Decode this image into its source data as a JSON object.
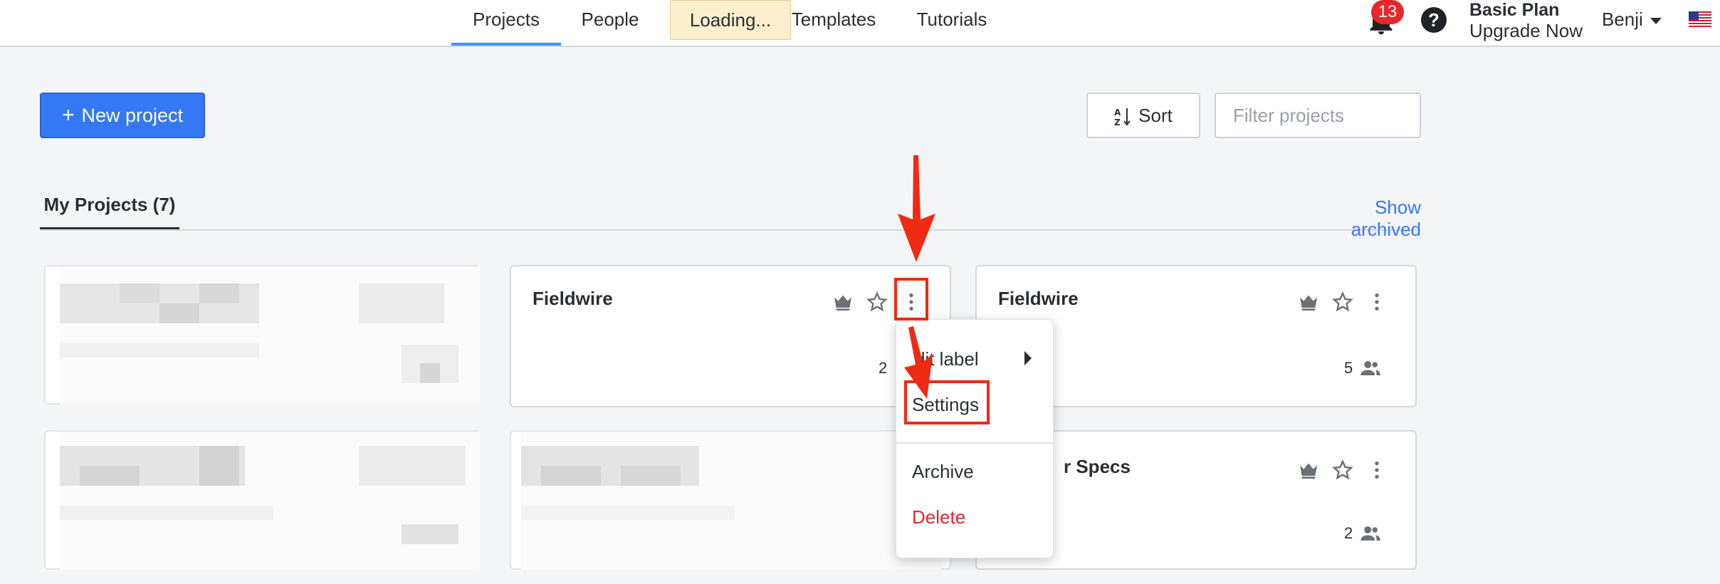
{
  "nav": {
    "tabs": [
      {
        "label": "Projects",
        "active": true
      },
      {
        "label": "People"
      },
      {
        "label": "Templates"
      },
      {
        "label": "Tutorials"
      }
    ],
    "loading_label": "Loading..."
  },
  "header": {
    "notification_count": "13",
    "help_label": "?",
    "plan_name": "Basic Plan",
    "upgrade_label": "Upgrade Now",
    "user_name": "Benji",
    "flag_icon": "us-flag-icon"
  },
  "toolbar": {
    "new_project_label": "New project",
    "sort_label": "Sort",
    "filter_placeholder": "Filter projects"
  },
  "section": {
    "tab_label": "My Projects (7)",
    "show_archived_label": "Show archived"
  },
  "cards": [
    {
      "title": "Fieldwire",
      "member_count": "2"
    },
    {
      "title": "Fieldwire",
      "member_count": "5"
    },
    {
      "title": "r Specs",
      "member_count": "2"
    }
  ],
  "menu": {
    "items": [
      "dit label",
      "Settings",
      "Archive",
      "Delete"
    ]
  },
  "colors": {
    "accent": "#3478f6",
    "danger": "#d92b2b",
    "annotation": "#ee2b12",
    "badge": "#e8262b"
  }
}
